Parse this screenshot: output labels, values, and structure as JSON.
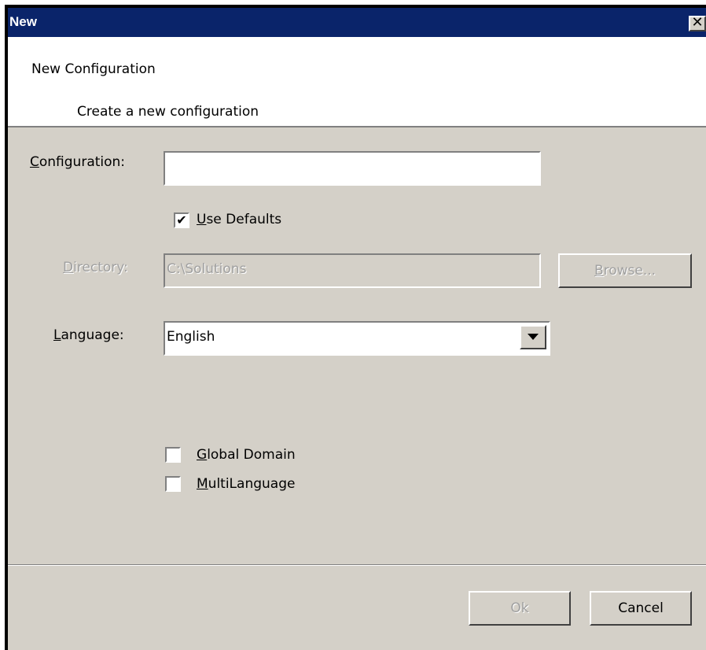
{
  "window": {
    "title": "New",
    "close_glyph": "✕"
  },
  "header": {
    "title": "New Configuration",
    "subtitle": "Create a new configuration"
  },
  "form": {
    "configuration": {
      "label_key": "C",
      "label_rest": "onfiguration:",
      "value": ""
    },
    "use_defaults": {
      "checked": true,
      "label_key": "U",
      "label_rest": "se Defaults",
      "check_glyph": "✔"
    },
    "directory": {
      "label_key": "D",
      "label_rest": "irectory:",
      "value": "C:\\Solutions"
    },
    "browse_button": {
      "label_key": "B",
      "label_rest": "rowse..."
    },
    "language": {
      "label_key": "L",
      "label_rest": "anguage:",
      "value": "English"
    },
    "global_domain": {
      "checked": false,
      "label_key": "G",
      "label_rest": "lobal Domain"
    },
    "multilanguage": {
      "checked": false,
      "label_key": "M",
      "label_rest": "ultiLanguage"
    }
  },
  "footer": {
    "ok_label": "Ok",
    "cancel_label": "Cancel"
  },
  "colors": {
    "titlebar": "#0a246a",
    "dialog_bg": "#d4d0c8",
    "disabled_text": "#a0a0a0"
  },
  "icons": [
    "close-icon",
    "checkmark-icon",
    "chevron-down-icon"
  ]
}
